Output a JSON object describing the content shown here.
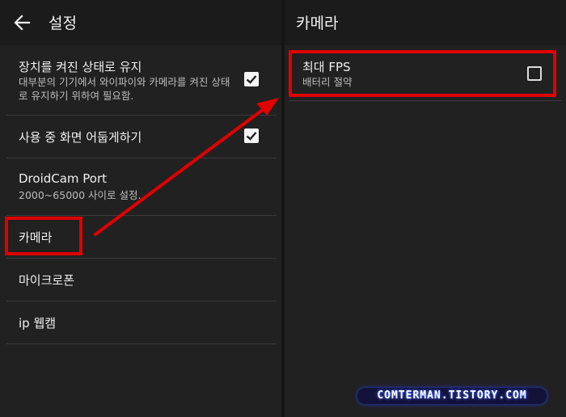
{
  "left": {
    "title": "설정",
    "items": [
      {
        "title": "장치를 켜진 상태로 유지",
        "summary": "대부분의 기기에서 와이파이와 카메라를 켜진 상태로 유지하기 위하여 필요함.",
        "checked": true
      },
      {
        "title": "사용 중 화면 어둡게하기",
        "checked": true
      },
      {
        "title": "DroidCam Port",
        "summary": "2000~65000 사이로 설정."
      },
      {
        "title": "카메라"
      },
      {
        "title": "마이크로폰"
      },
      {
        "title": "ip 웹캠"
      }
    ]
  },
  "right": {
    "title": "카메라",
    "items": [
      {
        "title": "최대 FPS",
        "summary": "배터리 절약",
        "checked": false
      }
    ]
  },
  "colors": {
    "highlight": "#e00000",
    "background": "#212121",
    "appbar": "#1b1b1b"
  },
  "icons": {
    "back": "arrow-back-icon",
    "checked": "check-icon"
  },
  "watermark": "COMTERMAN.TISTORY.COM"
}
